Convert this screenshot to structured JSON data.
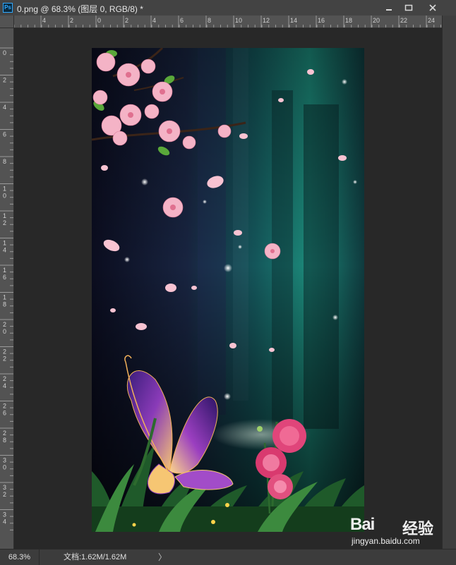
{
  "window": {
    "title": "0.png @ 68.3% (图层 0, RGB/8) *",
    "app_icon_label": "Ps",
    "buttons": [
      "minimize",
      "maximize",
      "close"
    ]
  },
  "rulers": {
    "horizontal_labels": [
      "4",
      "2",
      "0",
      "2",
      "4",
      "6",
      "8",
      "10",
      "12",
      "14",
      "16",
      "18",
      "20",
      "22",
      "24"
    ],
    "vertical_labels": [
      "0",
      "2",
      "4",
      "6",
      "8",
      "10",
      "12",
      "14",
      "16",
      "18",
      "20",
      "22",
      "24",
      "26",
      "28",
      "30",
      "32",
      "34"
    ]
  },
  "canvas": {
    "image_description_icon": "fairy-forest-image",
    "colors": {
      "forest_teal": "#1f8a78",
      "dark_bg": "#0d0f1e",
      "blossom_pink": "#f2a9c0",
      "butterfly_purple": "#6a2ea8",
      "rose_pink": "#e0457a"
    }
  },
  "status": {
    "zoom": "68.3%",
    "doc_info": "文档:1.62M/1.62M",
    "arrow": "〉"
  },
  "watermark": {
    "logo": "Bai",
    "logo_suffix": "经验",
    "url": "jingyan.baidu.com"
  }
}
